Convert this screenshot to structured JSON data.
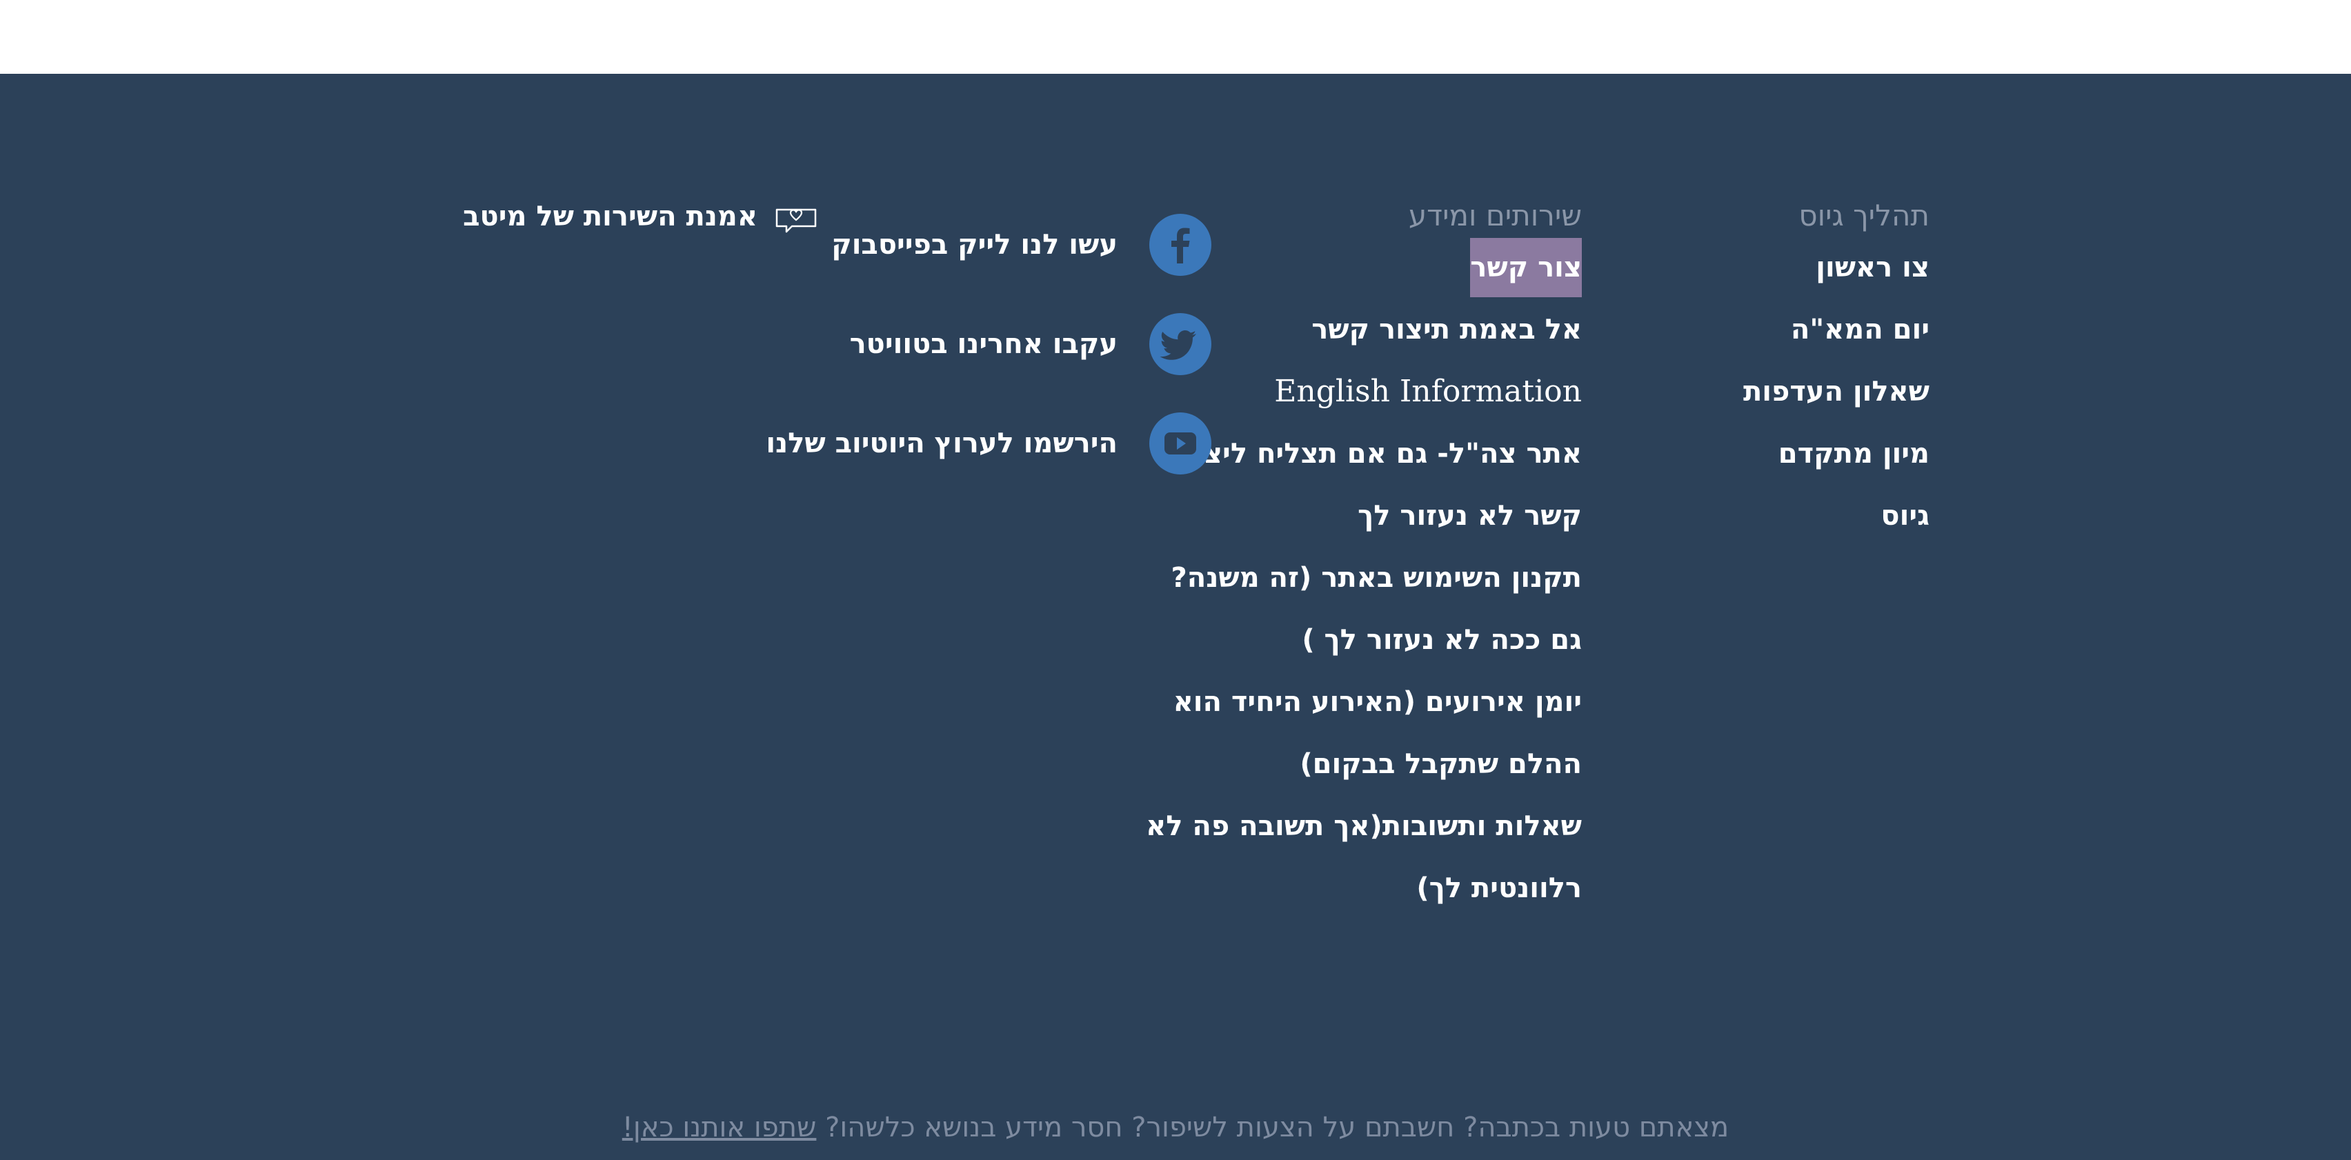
{
  "columns": {
    "process": {
      "heading": "תהליך גיוס",
      "links": [
        "צו ראשון",
        "יום המא\"ה",
        "שאלון העדפות",
        "מיון מתקדם",
        "גיוס"
      ]
    },
    "services": {
      "heading": "שירותים ומידע",
      "links": [
        "צור קשר",
        "אל באמת תיצור קשר",
        "English Information",
        "אתר צה\"ל- גם אם תצליח ליצור",
        "קשר לא נעזור לך",
        "תקנון השימוש באתר (זה משנה?",
        "גם ככה לא נעזור לך )",
        "יומן אירועים (האירוע היחיד הוא",
        "ההלם שתקבל בבקום)",
        "שאלות ותשובות(אך תשובה פה לא",
        "רלוונטית לך)"
      ]
    }
  },
  "social": {
    "items": [
      {
        "label": "עשו לנו לייק בפייסבוק",
        "icon": "facebook-icon"
      },
      {
        "label": "עקבו אחרינו בטוויטר",
        "icon": "twitter-icon"
      },
      {
        "label": "הירשמו לערוץ היוטיוב שלנו",
        "icon": "youtube-icon"
      }
    ]
  },
  "quality": {
    "label": "אמנת השירות של מיטב",
    "icon": "chat-heart-icon"
  },
  "feedback": {
    "text": "מצאתם טעות בכתבה? חשבתם על הצעות לשיפור? חסר מידע בנושא כלשהו?",
    "link": "שתפו אותנו כאן!"
  },
  "colors": {
    "footer_bg": "#2c4159",
    "icon_circle": "#3b78ba",
    "highlight": "#8b7aa0",
    "muted_text": "#8a96a8"
  }
}
